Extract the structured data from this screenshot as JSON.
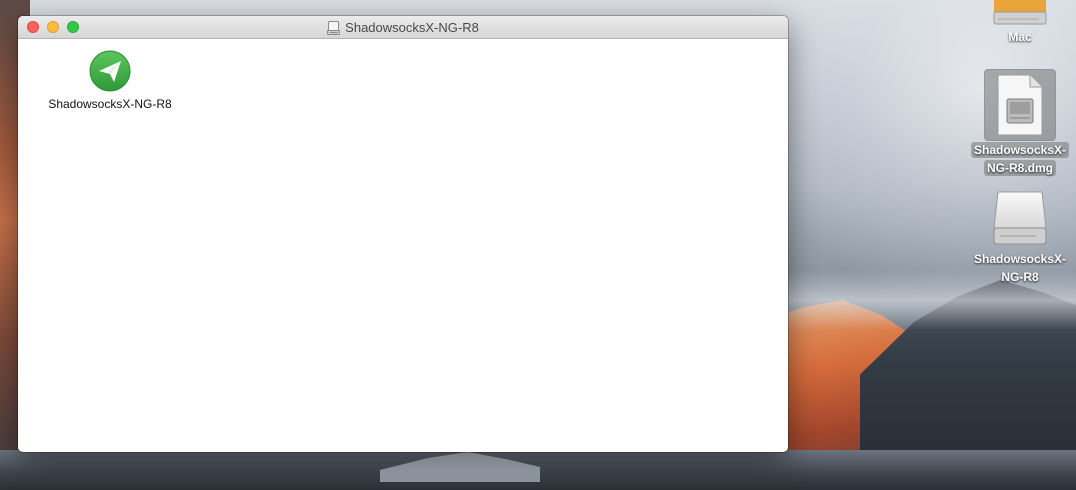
{
  "window": {
    "title": "ShadowsocksX-NG-R8",
    "title_icon": "disk-image-icon",
    "items": [
      {
        "label": "ShadowsocksX-NG-R8",
        "icon": "shadowsocks-app-icon",
        "accent": "#3fae3f"
      }
    ]
  },
  "desktop": {
    "icons": [
      {
        "label": "Mac",
        "icon": "hard-drive-icon",
        "selected": false
      },
      {
        "label_line1": "ShadowsocksX-",
        "label_line2": "NG-R8.dmg",
        "icon": "dmg-file-icon",
        "selected": true
      },
      {
        "label_line1": "ShadowsocksX-",
        "label_line2": "NG-R8",
        "icon": "mounted-volume-icon",
        "selected": false
      }
    ]
  },
  "colors": {
    "close": "#fc605c",
    "minimize": "#fdbc40",
    "zoom": "#34c84a",
    "app_green": "#3fae3f"
  }
}
